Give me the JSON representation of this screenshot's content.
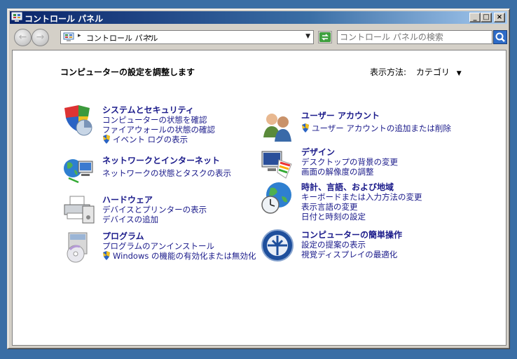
{
  "window": {
    "title": "コントロール パネル"
  },
  "address": {
    "crumb": "コントロール パネル"
  },
  "search": {
    "placeholder": "コントロール パネルの検索"
  },
  "main": {
    "heading": "コンピューターの設定を調整します",
    "view_by_label": "表示方法:",
    "view_by_value": "カテゴリ"
  },
  "categories": [
    {
      "title": "システムとセキュリティ",
      "icon": "shield-chart-icon",
      "links": [
        {
          "text": "コンピューターの状態を確認",
          "shield": false
        },
        {
          "text": "ファイアウォールの状態の確認",
          "shield": false
        },
        {
          "text": "イベント ログの表示",
          "shield": true
        }
      ]
    },
    {
      "title": "ネットワークとインターネット",
      "icon": "network-globe-icon",
      "links": [
        {
          "text": "ネットワークの状態とタスクの表示",
          "shield": false
        }
      ]
    },
    {
      "title": "ハードウェア",
      "icon": "printer-icon",
      "links": [
        {
          "text": "デバイスとプリンターの表示",
          "shield": false
        },
        {
          "text": "デバイスの追加",
          "shield": false
        }
      ]
    },
    {
      "title": "プログラム",
      "icon": "programs-disc-icon",
      "links": [
        {
          "text": "プログラムのアンインストール",
          "shield": false
        },
        {
          "text": "Windows の機能の有効化または無効化",
          "shield": true
        }
      ]
    },
    {
      "title": "ユーザー アカウント",
      "icon": "users-icon",
      "links": [
        {
          "text": "ユーザー アカウントの追加または削除",
          "shield": true
        }
      ]
    },
    {
      "title": "デザイン",
      "icon": "display-palette-icon",
      "links": [
        {
          "text": "デスクトップの背景の変更",
          "shield": false
        },
        {
          "text": "画面の解像度の調整",
          "shield": false
        }
      ]
    },
    {
      "title": "時計、言語、および地域",
      "icon": "clock-globe-icon",
      "links": [
        {
          "text": "キーボードまたは入力方法の変更",
          "shield": false
        },
        {
          "text": "表示言語の変更",
          "shield": false
        },
        {
          "text": "日付と時刻の設定",
          "shield": false
        }
      ]
    },
    {
      "title": "コンピューターの簡単操作",
      "icon": "ease-of-access-icon",
      "links": [
        {
          "text": "設定の提案の表示",
          "shield": false
        },
        {
          "text": "視覚ディスプレイの最適化",
          "shield": false
        }
      ]
    }
  ]
}
